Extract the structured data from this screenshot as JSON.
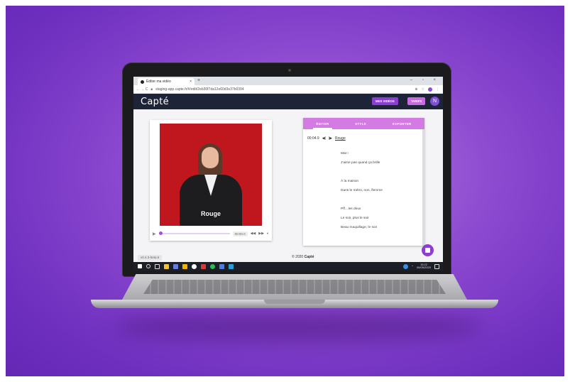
{
  "browser": {
    "tab_title": "Éditer ma vidéo",
    "tab_close": "×",
    "new_tab": "+",
    "window_controls": "– ▫ ×",
    "nav": "← → C",
    "url": "staging-app.capte.fr/#/edit/2eb30f7da12e60d3e37b0394"
  },
  "app": {
    "logo": "Capté",
    "btn_videos": "MES VIDÉOS",
    "btn_tarifs": "TARIFS",
    "avatar": "N",
    "accent": "#8b3fd0"
  },
  "player": {
    "subtitle": "Rouge",
    "time": "00:00.0",
    "play_icon": "play-icon",
    "progress": 0.0
  },
  "editor": {
    "tabs": [
      "ÉDITER",
      "STYLE",
      "EXPORTER"
    ],
    "active_tab": "ÉDITER",
    "current_time": "00:04.9",
    "current_word": "Rouge",
    "lines": [
      "Mat !",
      "J'aime pas quand ça brille",
      "",
      "À la maison",
      "Dans le métro, non, flemme",
      "",
      "Pff…les deux",
      "Le soir, plus le soir",
      "Beau maquillage, le soir"
    ]
  },
  "footer": {
    "version": "v0.4.3-beta.5",
    "copyright_prefix": "© 2020",
    "copyright_brand": "Capté"
  },
  "taskbar": {
    "time": "15:22",
    "date": "06/05/2020"
  }
}
